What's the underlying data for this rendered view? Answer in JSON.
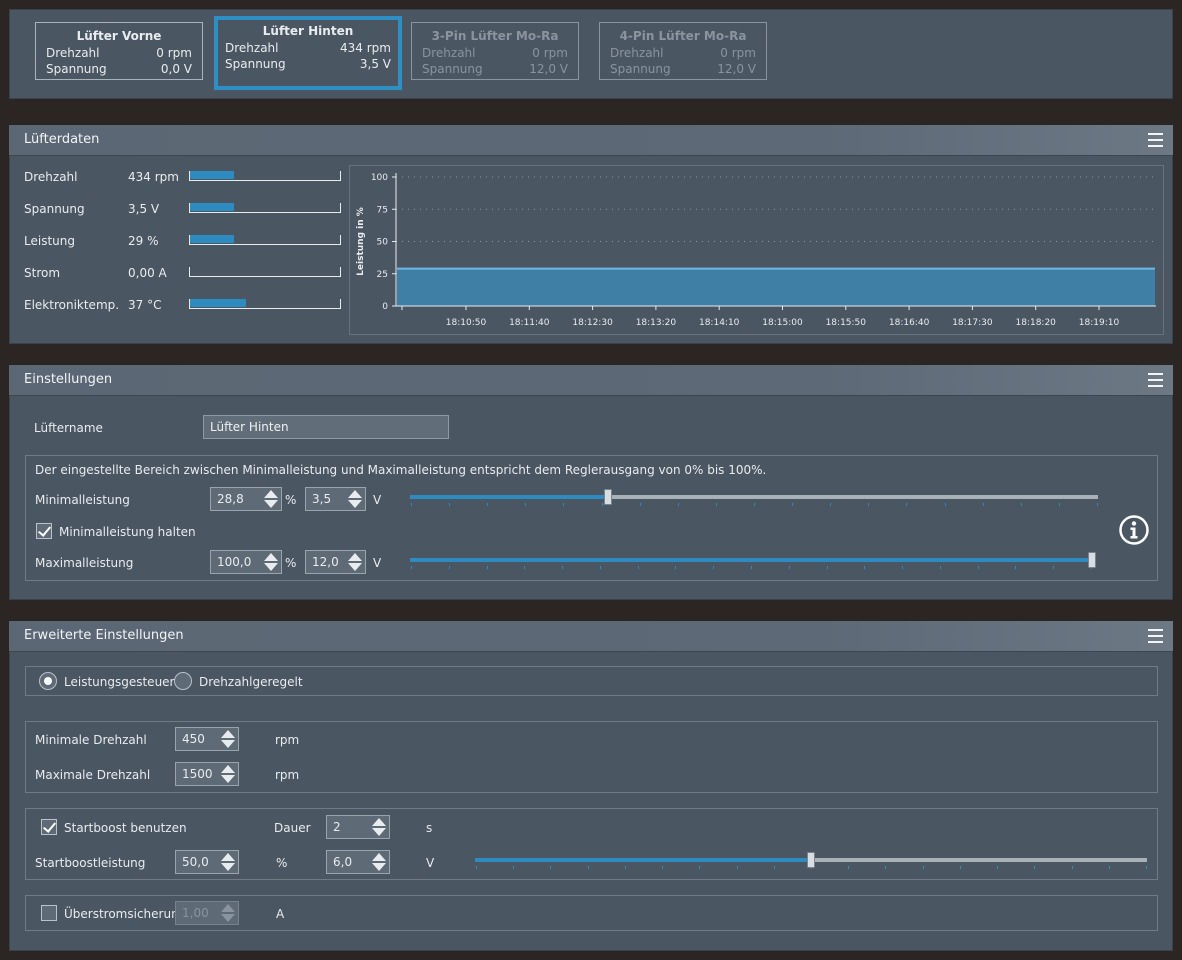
{
  "fans": [
    {
      "title": "Lüfter Vorne",
      "rpm_label": "Drehzahl",
      "rpm": "0 rpm",
      "volt_label": "Spannung",
      "volt": "0,0 V"
    },
    {
      "title": "Lüfter Hinten",
      "rpm_label": "Drehzahl",
      "rpm": "434 rpm",
      "volt_label": "Spannung",
      "volt": "3,5 V"
    },
    {
      "title": "3-Pin Lüfter Mo-Ra",
      "rpm_label": "Drehzahl",
      "rpm": "0 rpm",
      "volt_label": "Spannung",
      "volt": "12,0 V"
    },
    {
      "title": "4-Pin Lüfter Mo-Ra",
      "rpm_label": "Drehzahl",
      "rpm": "0 rpm",
      "volt_label": "Spannung",
      "volt": "12,0 V"
    }
  ],
  "fandata": {
    "header": "Lüfterdaten",
    "rows": [
      {
        "label": "Drehzahl",
        "value": "434 rpm",
        "fraction": 0.29
      },
      {
        "label": "Spannung",
        "value": "3,5 V",
        "fraction": 0.29
      },
      {
        "label": "Leistung",
        "value": "29 %",
        "fraction": 0.29
      },
      {
        "label": "Strom",
        "value": "0,00 A",
        "fraction": 0
      },
      {
        "label": "Elektroniktemp.",
        "value": "37 °C",
        "fraction": 0.37
      }
    ]
  },
  "chart_data": {
    "type": "area",
    "title": "",
    "xlabel": "",
    "ylabel": "Leistung in %",
    "ylim": [
      0,
      100
    ],
    "yticks": [
      "0",
      "25",
      "50",
      "75",
      "100"
    ],
    "x": [
      "18:10:50",
      "18:11:40",
      "18:12:30",
      "18:13:20",
      "18:14:10",
      "18:15:00",
      "18:15:50",
      "18:16:40",
      "18:17:30",
      "18:18:20",
      "18:19:10"
    ],
    "series": [
      {
        "values": [
          29,
          29,
          29,
          29,
          29,
          29,
          29,
          29,
          29,
          29,
          29
        ]
      }
    ],
    "grid": true,
    "color": "#3f7fa6",
    "line_color": "#6fb8e6"
  },
  "settings": {
    "header": "Einstellungen",
    "name_label": "Lüftername",
    "name_value": "Lüfter Hinten",
    "info_text": "Der eingestellte Bereich zwischen Minimalleistung und Maximalleistung entspricht dem Reglerausgang von 0% bis 100%.",
    "min_label": "Minimalleistung",
    "min_percent": "28,8",
    "min_volt": "3,5",
    "min_fraction": 0.288,
    "hold_label": "Minimalleistung halten",
    "max_label": "Maximalleistung",
    "max_percent": "100,0",
    "max_volt": "12,0",
    "max_fraction": 1.0,
    "unit_percent": "%",
    "unit_volt": "V"
  },
  "advanced": {
    "header": "Erweiterte Einstellungen",
    "mode_power": "Leistungsgesteuert",
    "mode_rpm": "Drehzahlgeregelt",
    "min_rpm_label": "Minimale Drehzahl",
    "min_rpm": "450",
    "max_rpm_label": "Maximale Drehzahl",
    "max_rpm": "1500",
    "rpm_unit": "rpm",
    "boost_label": "Startboost benutzen",
    "duration_label": "Dauer",
    "duration": "2",
    "duration_unit": "s",
    "boost_power_label": "Startboostleistung",
    "boost_percent": "50,0",
    "boost_volt": "6,0",
    "boost_fraction": 0.5,
    "unit_percent": "%",
    "unit_volt": "V",
    "overcurrent_label": "Überstromsicherung",
    "overcurrent_value": "1,00",
    "overcurrent_unit": "A"
  }
}
